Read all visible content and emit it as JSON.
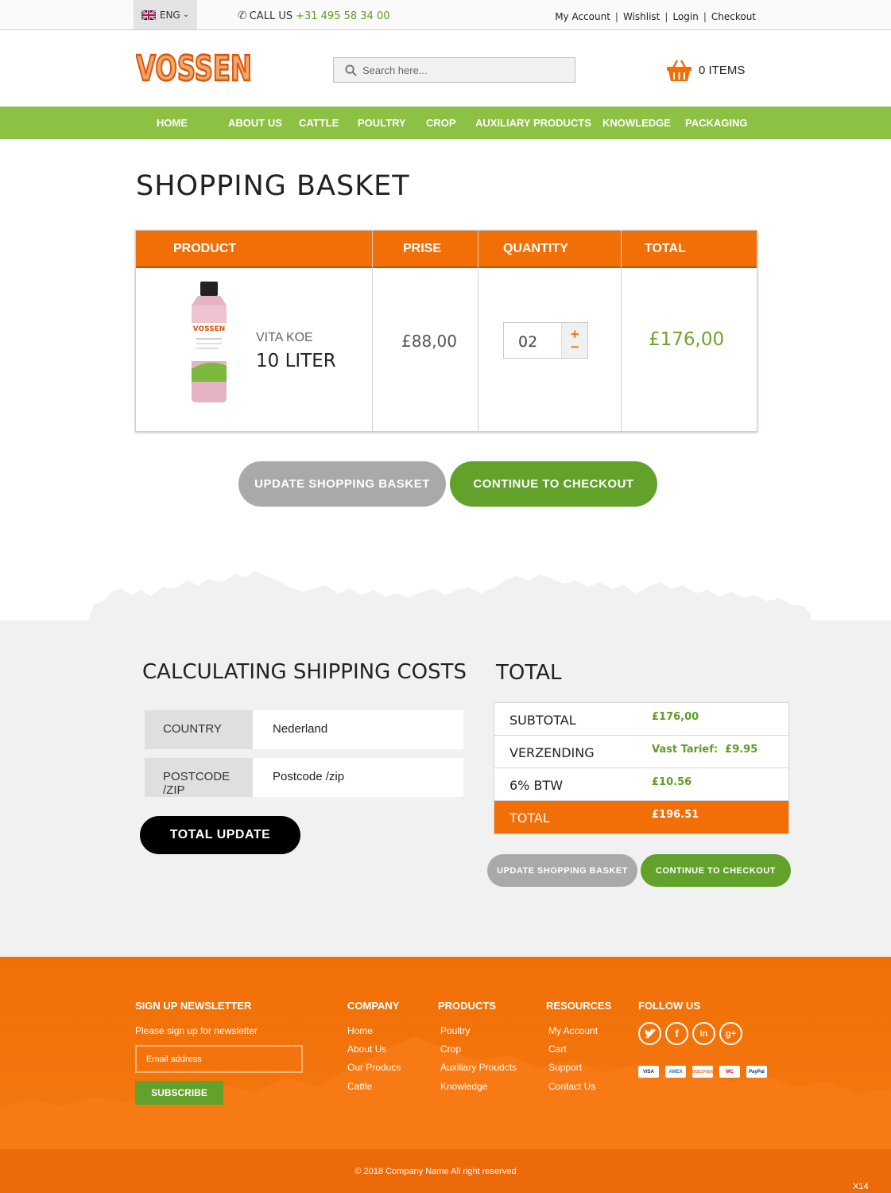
{
  "topbar": {
    "language": "ENG",
    "call_label": "CALL US",
    "phone": "+31 495 58 34 00",
    "links": [
      "My Account",
      "Wishlist",
      "Login",
      "Checkout"
    ]
  },
  "header": {
    "logo_text": "VOSSEN",
    "search_placeholder": "Search here...",
    "cart_label": "0 ITEMS"
  },
  "nav": [
    "HOME",
    "ABOUT US",
    "CATTLE",
    "POULTRY",
    "CROP",
    "AUXILIARY PRODUCTS",
    "KNOWLEDGE",
    "PACKAGING"
  ],
  "basket": {
    "title": "SHOPPING BASKET",
    "columns": [
      "PRODUCT",
      "PRISE",
      "QUANTITY",
      "TOTAL"
    ],
    "item": {
      "name": "VITA KOE",
      "size": "10 LITER",
      "price": "£88,00",
      "quantity": "02",
      "total": "£176,00"
    },
    "update_button": "UPDATE SHOPPING BASKET",
    "checkout_button": "CONTINUE TO CHECKOUT"
  },
  "shipping": {
    "title": "CALCULATING SHIPPING COSTS",
    "country_label": "COUNTRY",
    "country_value": "Nederland",
    "postcode_label": "POSTCODE /ZIP",
    "postcode_placeholder": "Postcode /zip",
    "total_update_button": "TOTAL UPDATE"
  },
  "totals": {
    "title": "TOTAL",
    "rows": [
      {
        "label": "SUBTOTAL",
        "value": "£176,00"
      },
      {
        "label": "VERZENDING",
        "value": "Vast Tarief:  £9.95"
      },
      {
        "label": "6% BTW",
        "value": "£10.56"
      },
      {
        "label": "TOTAL",
        "value": "£196.51"
      }
    ],
    "update_button": "UPDATE SHOPPING BASKET",
    "checkout_button": "CONTINUE TO CHECKOUT"
  },
  "footer": {
    "newsletter_title": "SIGN UP NEWSLETTER",
    "newsletter_text": "Please sign up for newsletter",
    "email_placeholder": "Email address",
    "subscribe_button": "SUBSCRIBE",
    "company_title": "COMPANY",
    "company_links": [
      "Home",
      "About Us",
      "Our Producs",
      "Cattle"
    ],
    "products_title": "PRODUCTS",
    "products_links": [
      "Poultry",
      "Crop",
      "Auxiliary Proudcts",
      "Knowledge"
    ],
    "resources_title": "RESOURCES",
    "resources_links": [
      "My Account",
      "Cart",
      "Support",
      "Contact Us"
    ],
    "follow_title": "FOLLOW US",
    "social_icons": [
      "twitter-icon",
      "facebook-icon",
      "linkedin-icon",
      "google-plus-icon"
    ],
    "payment_icons": [
      "VISA",
      "AMEX",
      "DISCOVER",
      "MC",
      "PayPal"
    ],
    "copyright": "© 2018 Company Name  All right reserved",
    "corner_label": "X14"
  },
  "colors": {
    "orange": "#f26f07",
    "green": "#8cc143",
    "dark_green": "#62a22a",
    "grey_button": "#a9a9a9"
  }
}
